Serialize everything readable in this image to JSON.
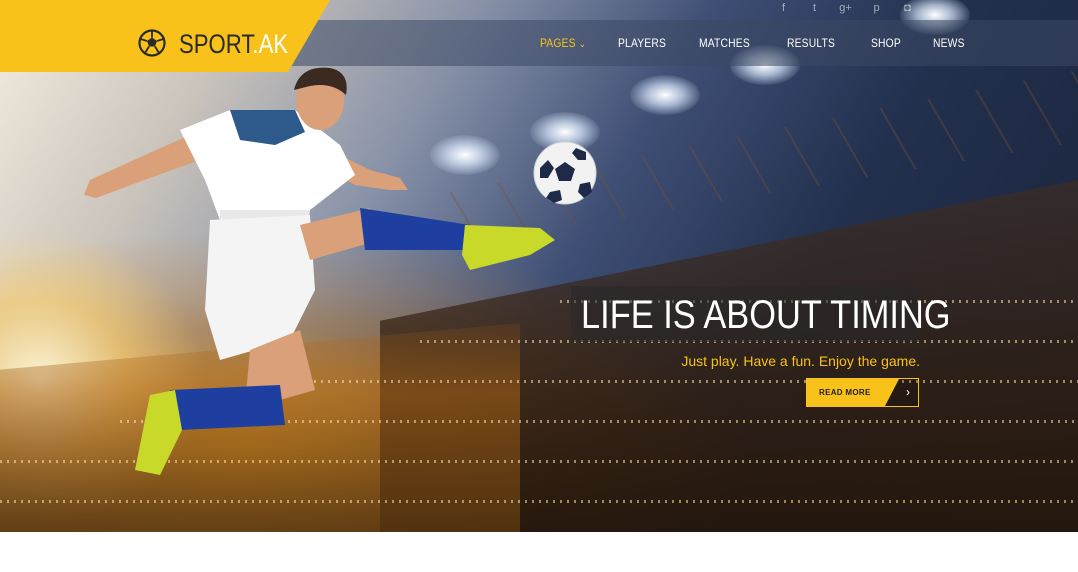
{
  "brand": {
    "name_main": "SPORT",
    "name_accent": ".AK",
    "logo_icon": "soccer-ball-icon",
    "accent_color": "#f9c21a"
  },
  "social": [
    {
      "name": "facebook",
      "glyph": "f"
    },
    {
      "name": "twitter",
      "glyph": "t"
    },
    {
      "name": "google-plus",
      "glyph": "g+"
    },
    {
      "name": "pinterest",
      "glyph": "p"
    },
    {
      "name": "instagram",
      "glyph": "◘"
    }
  ],
  "nav": {
    "items": [
      {
        "label": "PAGES",
        "active": true,
        "has_dropdown": true
      },
      {
        "label": "PLAYERS"
      },
      {
        "label": "MATCHES"
      },
      {
        "label": "RESULTS"
      },
      {
        "label": "SHOP"
      },
      {
        "label": "NEWS"
      }
    ],
    "dropdown_glyph": "⌄"
  },
  "hero": {
    "headline": "LIFE IS ABOUT TIMING",
    "tagline": "Just play. Have a fun. Enjoy the game.",
    "cta_label": "READ MORE",
    "cta_arrow": "›"
  }
}
